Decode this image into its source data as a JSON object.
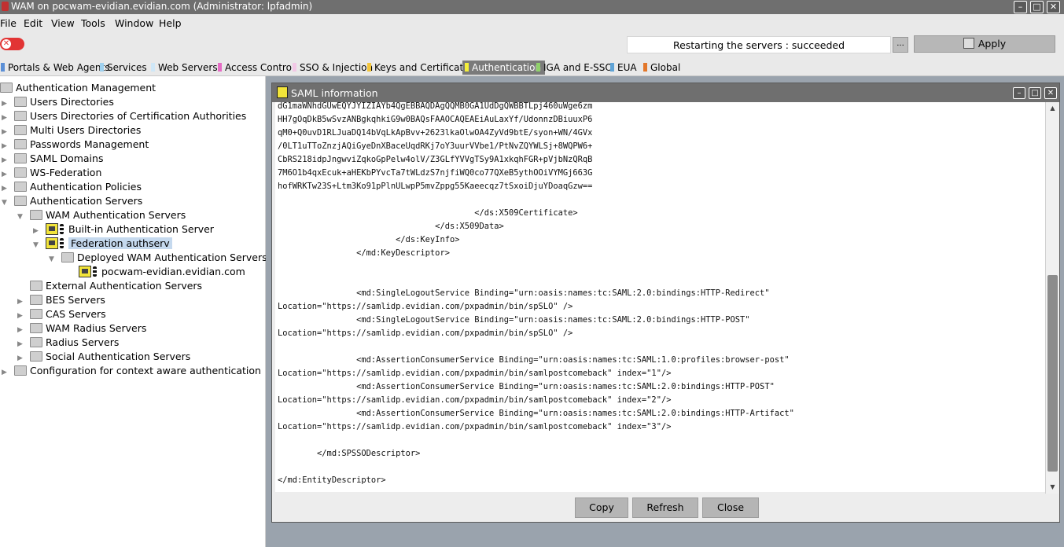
{
  "window": {
    "title": "WAM on pocwam-evidian.evidian.com (Administrator: lpfadmin)",
    "minimize": "–",
    "maximize": "□",
    "close": "✕"
  },
  "menu": [
    "File",
    "Edit",
    "View",
    "Tools",
    "Window",
    "Help"
  ],
  "toolbar": {
    "status_text": "Restarting the servers : succeeded",
    "more_label": "...",
    "apply_label": "Apply"
  },
  "tabs": [
    {
      "label": "Portals & Web Agents",
      "color": "#5b8fd6"
    },
    {
      "label": "Services",
      "color": "#9fd1ef"
    },
    {
      "label": "Web Servers",
      "color": "#cfe7f7"
    },
    {
      "label": "Access Control",
      "color": "#e56bc4"
    },
    {
      "label": "SSO & Injection",
      "color": "#f2c8e6"
    },
    {
      "label": "Keys and Certificates",
      "color": "#f3c53a"
    },
    {
      "label": "Authentication",
      "color": "#f4ee3a",
      "active": true
    },
    {
      "label": "IGA and E-SSO",
      "color": "#8fd16a"
    },
    {
      "label": "EUA",
      "color": "#5fa3d6"
    },
    {
      "label": "Global",
      "color": "#e3772a"
    }
  ],
  "tree": {
    "root": "Authentication Management",
    "items": [
      "Users Directories",
      "Users Directories of Certification Authorities",
      "Multi Users Directories",
      "Passwords Management",
      "SAML Domains",
      "WS-Federation",
      "Authentication Policies",
      "Authentication Servers",
      "WAM Authentication Servers",
      "Built-in Authentication Server",
      "Federation authserv",
      "Deployed WAM Authentication Servers",
      "pocwam-evidian.evidian.com",
      "External Authentication Servers",
      "BES Servers",
      "CAS Servers",
      "WAM Radius Servers",
      "Radius Servers",
      "Social Authentication Servers",
      "Configuration for context aware authentication"
    ]
  },
  "dialog": {
    "title": "SAML information",
    "content": "dG1maWNhdGUwEQYJYIZIAYb4QgEBBAQDAgQQMB0GA1UdDgQWBBTLpj460uWge6zm\nHH7gOqDkB5wSvzANBgkqhkiG9w0BAQsFAAOCAQEAEiAuLaxYf/UdonnzDBiuuxP6\nqM0+Q0uvD1RLJuaDQ14bVqLkApBvv+2623lkaOlwOA4ZyVd9btE/syon+WN/4GVx\n/0LT1uTToZnzjAQiGyeDnXBaceUqdRKj7oY3uurVVbe1/PtNvZQYWLSj+8WQPW6+\nCbRS218idpJngwviZqkoGpPelw4olV/Z3GLfYVVgTSy9A1xkqhFGR+pVjbNzQRqB\n7M6O1b4qxEcuk+aHEKbPYvcTa7tWLdzS7njfiWQ0co77QXeB5ythOOiVYMGj663G\nhofWRKTw23S+Ltm3Ko91pPlnULwpP5mvZppg55Kaeecqz7tSxoiDjuYDoaqGzw==\n\n                                        </ds:X509Certificate>\n                                </ds:X509Data>\n                        </ds:KeyInfo>\n                </md:KeyDescriptor>\n\n\n                <md:SingleLogoutService Binding=\"urn:oasis:names:tc:SAML:2.0:bindings:HTTP-Redirect\"\nLocation=\"https://samlidp.evidian.com/pxpadmin/bin/spSLO\" />\n                <md:SingleLogoutService Binding=\"urn:oasis:names:tc:SAML:2.0:bindings:HTTP-POST\"\nLocation=\"https://samlidp.evidian.com/pxpadmin/bin/spSLO\" />\n\n                <md:AssertionConsumerService Binding=\"urn:oasis:names:tc:SAML:1.0:profiles:browser-post\"\nLocation=\"https://samlidp.evidian.com/pxpadmin/bin/samlpostcomeback\" index=\"1\"/>\n                <md:AssertionConsumerService Binding=\"urn:oasis:names:tc:SAML:2.0:bindings:HTTP-POST\"\nLocation=\"https://samlidp.evidian.com/pxpadmin/bin/samlpostcomeback\" index=\"2\"/>\n                <md:AssertionConsumerService Binding=\"urn:oasis:names:tc:SAML:2.0:bindings:HTTP-Artifact\"\nLocation=\"https://samlidp.evidian.com/pxpadmin/bin/samlpostcomeback\" index=\"3\"/>\n\n        </md:SPSSODescriptor>\n\n</md:EntityDescriptor>",
    "buttons": {
      "copy": "Copy",
      "refresh": "Refresh",
      "close": "Close"
    }
  }
}
